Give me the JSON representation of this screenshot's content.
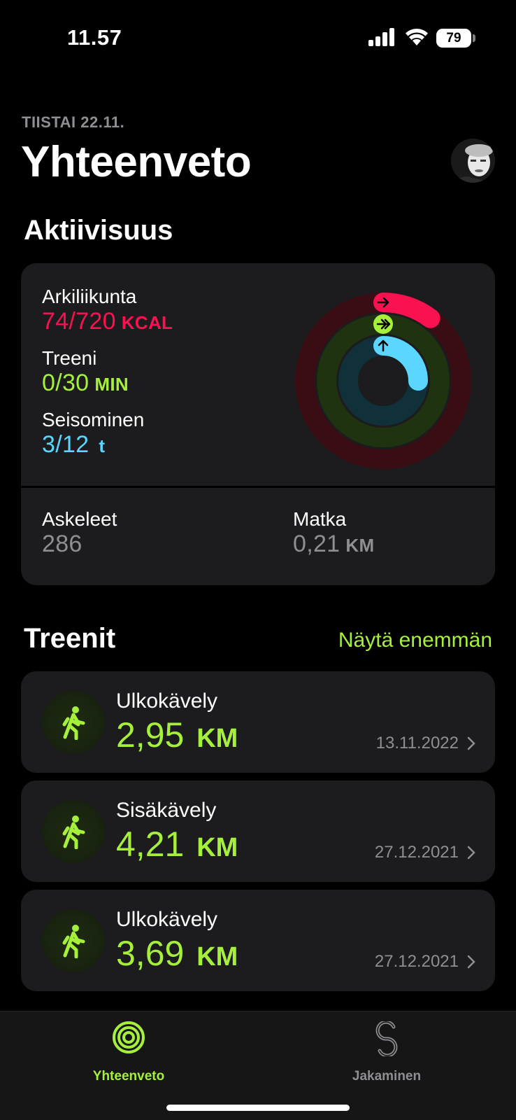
{
  "status_bar": {
    "time": "11.57",
    "battery": "79"
  },
  "header": {
    "date": "TIISTAI 22.11.",
    "title": "Yhteenveto"
  },
  "activity": {
    "section_title": "Aktiivisuus",
    "move": {
      "label": "Arkiliikunta",
      "value": "74/720",
      "unit": "KCAL",
      "color": "#fa114f",
      "progress": 0.103
    },
    "exercise": {
      "label": "Treeni",
      "value": "0/30",
      "unit": "MIN",
      "color": "#a6f03c",
      "progress": 0.0
    },
    "stand": {
      "label": "Seisominen",
      "value": "3/12",
      "unit": "t",
      "color": "#5ad6ff",
      "progress": 0.25
    },
    "steps": {
      "label": "Askeleet",
      "value": "286"
    },
    "distance": {
      "label": "Matka",
      "value": "0,21",
      "unit": "KM"
    }
  },
  "workouts": {
    "section_title": "Treenit",
    "more_label": "Näytä enemmän",
    "items": [
      {
        "name": "Ulkokävely",
        "distance": "2,95",
        "unit": "KM",
        "date": "13.11.2022",
        "icon": "walking-figure-icon"
      },
      {
        "name": "Sisäkävely",
        "distance": "4,21",
        "unit": "KM",
        "date": "27.12.2021",
        "icon": "walking-figure-icon"
      },
      {
        "name": "Ulkokävely",
        "distance": "3,69",
        "unit": "KM",
        "date": "27.12.2021",
        "icon": "walking-figure-icon"
      }
    ]
  },
  "tab_bar": {
    "tabs": [
      {
        "label": "Yhteenveto",
        "icon": "activity-rings-icon",
        "active": true,
        "color": "#a6f03c"
      },
      {
        "label": "Jakaminen",
        "icon": "sharing-icon",
        "active": false,
        "color": "#8e8e93"
      }
    ]
  },
  "colors": {
    "accent": "#a6f03c",
    "background": "#000000",
    "card": "#1c1c1e",
    "secondary_text": "#8e8e93"
  }
}
